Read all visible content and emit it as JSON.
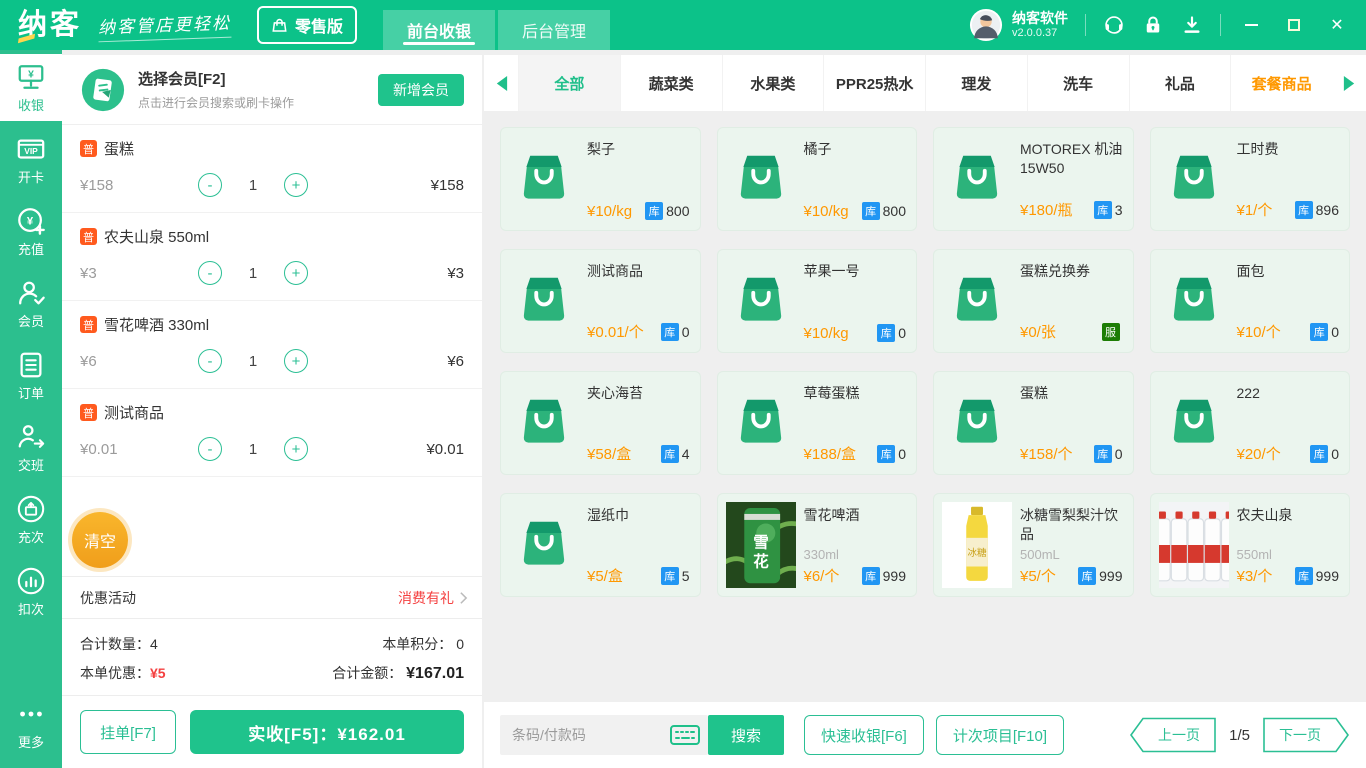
{
  "colors": {
    "topbar_green": "#0cc289",
    "sidebar_green": "#2cbf8e",
    "accent_green": "#1fc38c",
    "teal_border": "#2bbf94",
    "price_orange": "#ff9800",
    "stock_blue": "#2196f3",
    "service_green": "#1d7d05",
    "item_tag_orange": "#ff5a1e",
    "danger_red": "#f44040",
    "clear_orange": "#f5a81f"
  },
  "topbar": {
    "logo": "纳客",
    "tagline": "纳客管店更轻松",
    "edition": "零售版",
    "tabs": [
      {
        "label": "前台收银",
        "active": true
      },
      {
        "label": "后台管理",
        "active": false
      }
    ],
    "user": {
      "name": "纳客软件",
      "version": "v2.0.0.37"
    },
    "window": {
      "minimize": "",
      "maximize": "",
      "close": "✕"
    }
  },
  "sidebar": {
    "items": [
      {
        "label": "收银",
        "icon": "cash-register",
        "active": true
      },
      {
        "label": "开卡",
        "icon": "vip-card",
        "active": false
      },
      {
        "label": "充值",
        "icon": "recharge",
        "active": false
      },
      {
        "label": "会员",
        "icon": "member",
        "active": false
      },
      {
        "label": "订单",
        "icon": "orders",
        "active": false
      },
      {
        "label": "交班",
        "icon": "shift",
        "active": false
      },
      {
        "label": "充次",
        "icon": "recharge-times",
        "active": false
      },
      {
        "label": "扣次",
        "icon": "deduct-times",
        "active": false
      },
      {
        "label": "更多",
        "icon": "more",
        "active": false
      }
    ]
  },
  "cart": {
    "member": {
      "title": "选择会员[F2]",
      "subtitle": "点击进行会员搜索或刷卡操作",
      "add_button": "新增会员"
    },
    "minus_glyph": "-",
    "plus_glyph": "+",
    "items": [
      {
        "badge": "普",
        "name": "蛋糕",
        "price": "¥158",
        "qty": "1",
        "total": "¥158"
      },
      {
        "badge": "普",
        "name": "农夫山泉 550ml",
        "price": "¥3",
        "qty": "1",
        "total": "¥3"
      },
      {
        "badge": "普",
        "name": "雪花啤酒 330ml",
        "price": "¥6",
        "qty": "1",
        "total": "¥6"
      },
      {
        "badge": "普",
        "name": "测试商品",
        "price": "¥0.01",
        "qty": "1",
        "total": "¥0.01"
      }
    ],
    "clear_button": "清空",
    "promo": {
      "label": "优惠活动",
      "value": "消费有礼"
    },
    "summary": {
      "qty_label": "合计数量：",
      "qty": "4",
      "points_label": "本单积分：",
      "points": "0",
      "discount_label": "本单优惠：",
      "discount": "¥5",
      "total_label": "合计金额：",
      "total": "¥167.01"
    },
    "hold_button": "挂单[F7]",
    "pay_button": "实收[F5]：¥162.01"
  },
  "catalog": {
    "categories": [
      {
        "label": "全部",
        "state": "active"
      },
      {
        "label": "蔬菜类",
        "state": ""
      },
      {
        "label": "水果类",
        "state": ""
      },
      {
        "label": "PPR25热水",
        "state": ""
      },
      {
        "label": "理发",
        "state": ""
      },
      {
        "label": "洗车",
        "state": ""
      },
      {
        "label": "礼品",
        "state": ""
      },
      {
        "label": "套餐商品",
        "state": "highlight"
      }
    ],
    "products": [
      {
        "name": "梨子",
        "subtitle": "",
        "price": "¥10/kg",
        "stock_label": "库",
        "stock": "800",
        "image": "bag",
        "service": false
      },
      {
        "name": "橘子",
        "subtitle": "",
        "price": "¥10/kg",
        "stock_label": "库",
        "stock": "800",
        "image": "bag",
        "service": false
      },
      {
        "name": "MOTOREX 机油 15W50",
        "subtitle": "",
        "price": "¥180/瓶",
        "stock_label": "库",
        "stock": "3",
        "image": "bag",
        "service": false
      },
      {
        "name": "工时费",
        "subtitle": "",
        "price": "¥1/个",
        "stock_label": "库",
        "stock": "896",
        "image": "bag",
        "service": false
      },
      {
        "name": "测试商品",
        "subtitle": "",
        "price": "¥0.01/个",
        "stock_label": "库",
        "stock": "0",
        "image": "bag",
        "service": false
      },
      {
        "name": "苹果一号",
        "subtitle": "",
        "price": "¥10/kg",
        "stock_label": "库",
        "stock": "0",
        "image": "bag",
        "service": false
      },
      {
        "name": "蛋糕兑换券",
        "subtitle": "",
        "price": "¥0/张",
        "stock_label": "服",
        "stock": "",
        "image": "bag",
        "service": true
      },
      {
        "name": "面包",
        "subtitle": "",
        "price": "¥10/个",
        "stock_label": "库",
        "stock": "0",
        "image": "bag",
        "service": false
      },
      {
        "name": "夹心海苔",
        "subtitle": "",
        "price": "¥58/盒",
        "stock_label": "库",
        "stock": "4",
        "image": "bag",
        "service": false
      },
      {
        "name": "草莓蛋糕",
        "subtitle": "",
        "price": "¥188/盒",
        "stock_label": "库",
        "stock": "0",
        "image": "bag",
        "service": false
      },
      {
        "name": "蛋糕",
        "subtitle": "",
        "price": "¥158/个",
        "stock_label": "库",
        "stock": "0",
        "image": "bag",
        "service": false
      },
      {
        "name": "222",
        "subtitle": "",
        "price": "¥20/个",
        "stock_label": "库",
        "stock": "0",
        "image": "bag",
        "service": false
      },
      {
        "name": "湿纸巾",
        "subtitle": "",
        "price": "¥5/盒",
        "stock_label": "库",
        "stock": "5",
        "image": "bag",
        "service": false
      },
      {
        "name": "雪花啤酒",
        "subtitle": "330ml",
        "price": "¥6/个",
        "stock_label": "库",
        "stock": "999",
        "image": "beer-can",
        "service": false
      },
      {
        "name": "冰糖雪梨梨汁饮品",
        "subtitle": "500mL",
        "price": "¥5/个",
        "stock_label": "库",
        "stock": "999",
        "image": "juice-bottle",
        "service": false
      },
      {
        "name": "农夫山泉",
        "subtitle": "550ml",
        "price": "¥3/个",
        "stock_label": "库",
        "stock": "999",
        "image": "water-bottles",
        "service": false
      }
    ],
    "search": {
      "placeholder": "条码/付款码",
      "button": "搜索"
    },
    "quick_button": "快速收银[F6]",
    "count_button": "计次项目[F10]",
    "pagination": {
      "prev": "上一页",
      "page": "1/5",
      "next": "下一页"
    }
  }
}
